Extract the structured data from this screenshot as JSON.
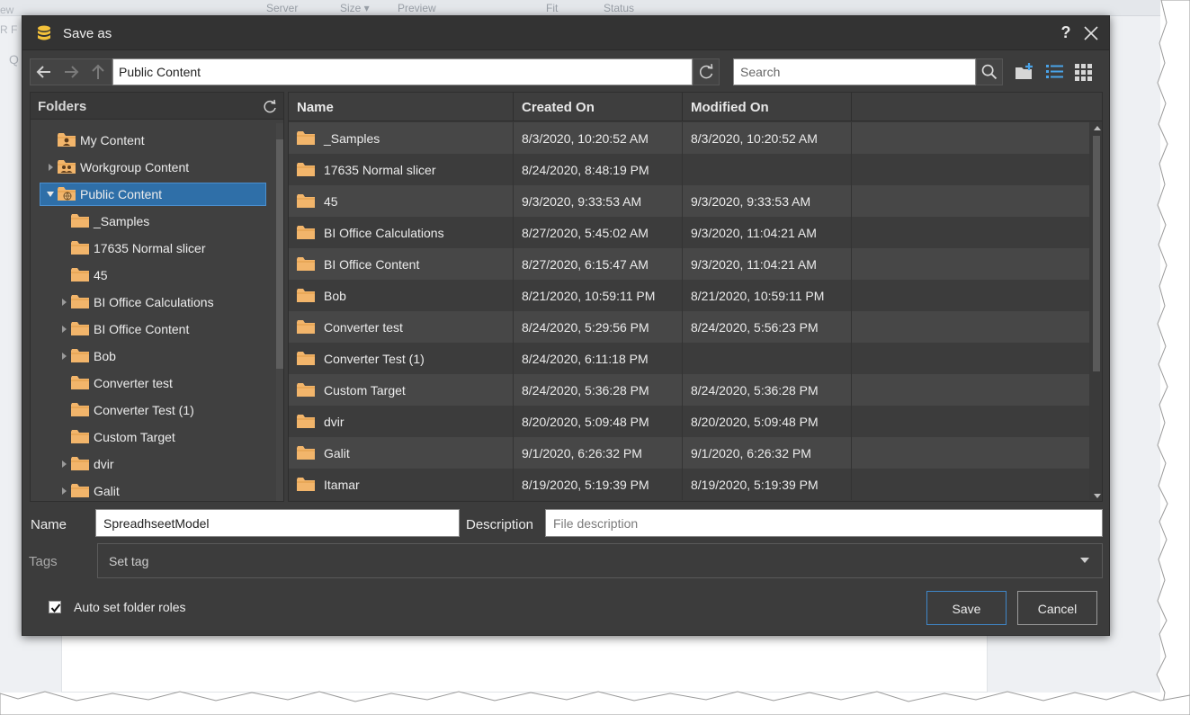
{
  "background": {
    "columns": [
      "Server",
      "Size ▾",
      "Preview",
      "Fit",
      "Status"
    ],
    "left_text": [
      "ew",
      "R F",
      "Q"
    ]
  },
  "dialog": {
    "title": "Save as",
    "help_label": "?",
    "path_value": "Public Content",
    "search_placeholder": "Search"
  },
  "folders": {
    "title": "Folders",
    "items": [
      {
        "label": "My Content",
        "level": 1,
        "arrow": "none",
        "icon": "user-folder",
        "selected": false
      },
      {
        "label": "Workgroup Content",
        "level": 1,
        "arrow": "right",
        "icon": "group-folder",
        "selected": false
      },
      {
        "label": "Public Content",
        "level": 1,
        "arrow": "down",
        "icon": "globe-folder",
        "selected": true
      },
      {
        "label": "_Samples",
        "level": 2,
        "arrow": "none",
        "icon": "folder",
        "selected": false
      },
      {
        "label": "17635 Normal slicer",
        "level": 2,
        "arrow": "none",
        "icon": "folder",
        "selected": false
      },
      {
        "label": "45",
        "level": 2,
        "arrow": "none",
        "icon": "folder",
        "selected": false
      },
      {
        "label": "BI Office Calculations",
        "level": 2,
        "arrow": "right",
        "icon": "folder",
        "selected": false
      },
      {
        "label": "BI Office Content",
        "level": 2,
        "arrow": "right",
        "icon": "folder",
        "selected": false
      },
      {
        "label": "Bob",
        "level": 2,
        "arrow": "right",
        "icon": "folder",
        "selected": false
      },
      {
        "label": "Converter test",
        "level": 2,
        "arrow": "none",
        "icon": "folder",
        "selected": false
      },
      {
        "label": "Converter Test (1)",
        "level": 2,
        "arrow": "none",
        "icon": "folder",
        "selected": false
      },
      {
        "label": "Custom Target",
        "level": 2,
        "arrow": "none",
        "icon": "folder",
        "selected": false
      },
      {
        "label": "dvir",
        "level": 2,
        "arrow": "right",
        "icon": "folder",
        "selected": false
      },
      {
        "label": "Galit",
        "level": 2,
        "arrow": "right",
        "icon": "folder",
        "selected": false
      }
    ]
  },
  "files": {
    "columns": [
      "Name",
      "Created On",
      "Modified On"
    ],
    "rows": [
      {
        "name": "_Samples",
        "created": "8/3/2020, 10:20:52 AM",
        "modified": "8/3/2020, 10:20:52 AM"
      },
      {
        "name": "17635 Normal slicer",
        "created": "8/24/2020, 8:48:19 PM",
        "modified": ""
      },
      {
        "name": "45",
        "created": "9/3/2020, 9:33:53 AM",
        "modified": "9/3/2020, 9:33:53 AM"
      },
      {
        "name": "BI Office Calculations",
        "created": "8/27/2020, 5:45:02 AM",
        "modified": "9/3/2020, 11:04:21 AM"
      },
      {
        "name": "BI Office Content",
        "created": "8/27/2020, 6:15:47 AM",
        "modified": "9/3/2020, 11:04:21 AM"
      },
      {
        "name": "Bob",
        "created": "8/21/2020, 10:59:11 PM",
        "modified": "8/21/2020, 10:59:11 PM"
      },
      {
        "name": "Converter test",
        "created": "8/24/2020, 5:29:56 PM",
        "modified": "8/24/2020, 5:56:23 PM"
      },
      {
        "name": "Converter Test (1)",
        "created": "8/24/2020, 6:11:18 PM",
        "modified": ""
      },
      {
        "name": "Custom Target",
        "created": "8/24/2020, 5:36:28 PM",
        "modified": "8/24/2020, 5:36:28 PM"
      },
      {
        "name": "dvir",
        "created": "8/20/2020, 5:09:48 PM",
        "modified": "8/20/2020, 5:09:48 PM"
      },
      {
        "name": "Galit",
        "created": "9/1/2020, 6:26:32 PM",
        "modified": "9/1/2020, 6:26:32 PM"
      },
      {
        "name": "Itamar",
        "created": "8/19/2020, 5:19:39 PM",
        "modified": "8/19/2020, 5:19:39 PM"
      }
    ]
  },
  "form": {
    "name_label": "Name",
    "name_value": "SpreadhseetModel",
    "description_label": "Description",
    "description_placeholder": "File description",
    "tags_label": "Tags",
    "tags_value": "Set tag",
    "auto_roles_label": "Auto set folder roles",
    "auto_roles_checked": true,
    "save_label": "Save",
    "cancel_label": "Cancel"
  },
  "colors": {
    "dialog_bg": "#3c3c3c",
    "selection": "#2f6fa8",
    "folder": "#f2b56b",
    "accent_border": "#3f86c8",
    "toolbar_icon": "#4aa3e8"
  },
  "icons": {
    "title": "database-icon",
    "back": "arrow-left-icon",
    "forward": "arrow-right-icon",
    "up": "arrow-up-icon",
    "refresh": "refresh-icon",
    "search": "search-icon",
    "new_folder": "new-folder-icon",
    "list_view": "list-view-icon",
    "grid_view": "grid-view-icon",
    "close": "close-icon"
  }
}
